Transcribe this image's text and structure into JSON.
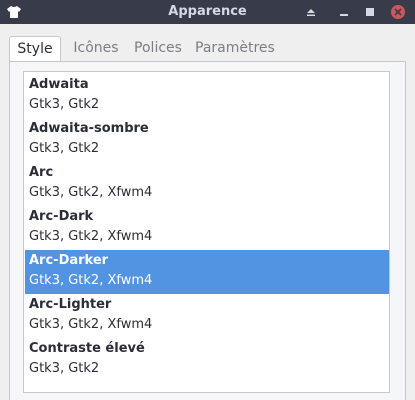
{
  "window": {
    "title": "Apparence",
    "colors": {
      "titlebar": "#383c4a",
      "close": "#cc575d",
      "selection": "#5294e2"
    },
    "icons": [
      "shirt-icon",
      "shade-icon",
      "minimize-icon",
      "maximize-icon",
      "close-icon"
    ]
  },
  "tabs": [
    {
      "label": "Style",
      "active": true
    },
    {
      "label": "Icônes",
      "active": false
    },
    {
      "label": "Polices",
      "active": false
    },
    {
      "label": "Paramètres",
      "active": false
    }
  ],
  "themes": [
    {
      "name": "Adwaita",
      "support": "Gtk3, Gtk2",
      "selected": false
    },
    {
      "name": "Adwaita-sombre",
      "support": "Gtk3, Gtk2",
      "selected": false
    },
    {
      "name": "Arc",
      "support": "Gtk3, Gtk2, Xfwm4",
      "selected": false
    },
    {
      "name": "Arc-Dark",
      "support": "Gtk3, Gtk2, Xfwm4",
      "selected": false
    },
    {
      "name": "Arc-Darker",
      "support": "Gtk3, Gtk2, Xfwm4",
      "selected": true
    },
    {
      "name": "Arc-Lighter",
      "support": "Gtk3, Gtk2, Xfwm4",
      "selected": false
    },
    {
      "name": "Contraste élevé",
      "support": "Gtk3, Gtk2",
      "selected": false
    }
  ]
}
